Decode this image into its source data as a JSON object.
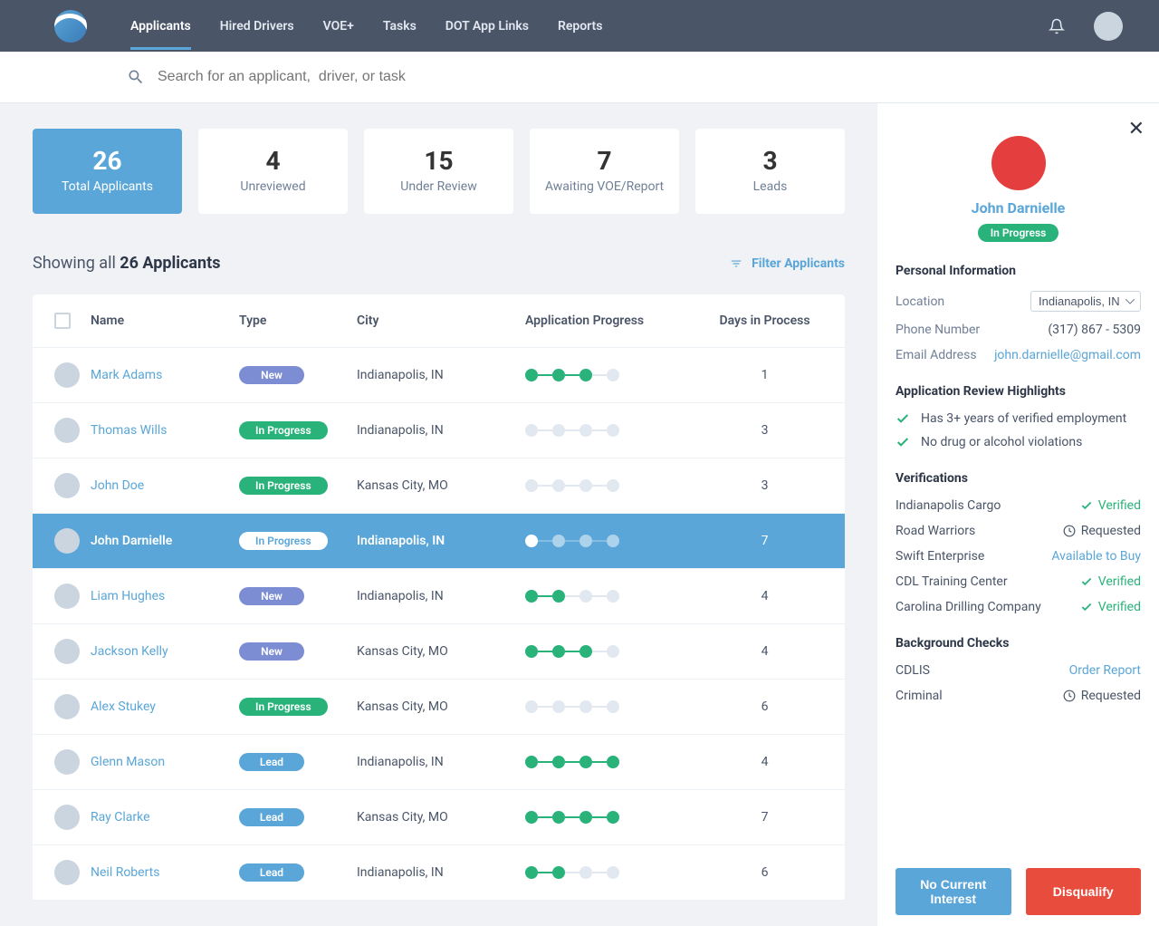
{
  "nav": {
    "items": [
      "Applicants",
      "Hired Drivers",
      "VOE+",
      "Tasks",
      "DOT App Links",
      "Reports"
    ],
    "active": 0
  },
  "search": {
    "placeholder": "Search for an applicant,  driver, or task"
  },
  "stats": [
    {
      "number": "26",
      "label": "Total Applicants",
      "active": true
    },
    {
      "number": "4",
      "label": "Unreviewed",
      "active": false
    },
    {
      "number": "15",
      "label": "Under Review",
      "active": false
    },
    {
      "number": "7",
      "label": "Awaiting VOE/Report",
      "active": false
    },
    {
      "number": "3",
      "label": "Leads",
      "active": false
    }
  ],
  "showing": {
    "prefix": "Showing all ",
    "strong": "26 Applicants"
  },
  "filter_label": "Filter Applicants",
  "columns": {
    "name": "Name",
    "type": "Type",
    "city": "City",
    "progress": "Application Progress",
    "days": "Days in Process"
  },
  "rows": [
    {
      "name": "Mark Adams",
      "type": "New",
      "type_class": "new",
      "city": "Indianapolis, IN",
      "progress": [
        1,
        1,
        1,
        0
      ],
      "days": "1",
      "selected": false
    },
    {
      "name": "Thomas Wills",
      "type": "In Progress",
      "type_class": "inprogress",
      "city": "Indianapolis, IN",
      "progress": [
        0,
        0,
        0,
        0
      ],
      "days": "3",
      "selected": false
    },
    {
      "name": "John Doe",
      "type": "In Progress",
      "type_class": "inprogress",
      "city": "Kansas City, MO",
      "progress": [
        0,
        0,
        0,
        0
      ],
      "days": "3",
      "selected": false
    },
    {
      "name": "John Darnielle",
      "type": "In Progress",
      "type_class": "inprogress",
      "city": "Indianapolis, IN",
      "progress": [
        1,
        0,
        0,
        0
      ],
      "days": "7",
      "selected": true
    },
    {
      "name": "Liam Hughes",
      "type": "New",
      "type_class": "new",
      "city": "Indianapolis, IN",
      "progress": [
        1,
        1,
        0,
        0
      ],
      "days": "4",
      "selected": false
    },
    {
      "name": "Jackson Kelly",
      "type": "New",
      "type_class": "new",
      "city": "Kansas City, MO",
      "progress": [
        1,
        1,
        1,
        0
      ],
      "days": "4",
      "selected": false
    },
    {
      "name": "Alex Stukey",
      "type": "In Progress",
      "type_class": "inprogress",
      "city": "Kansas City, MO",
      "progress": [
        0,
        0,
        0,
        0
      ],
      "days": "6",
      "selected": false
    },
    {
      "name": "Glenn Mason",
      "type": "Lead",
      "type_class": "lead",
      "city": "Indianapolis, IN",
      "progress": [
        1,
        1,
        1,
        1
      ],
      "days": "4",
      "selected": false
    },
    {
      "name": "Ray Clarke",
      "type": "Lead",
      "type_class": "lead",
      "city": "Kansas City, MO",
      "progress": [
        1,
        1,
        1,
        1
      ],
      "days": "7",
      "selected": false
    },
    {
      "name": "Neil Roberts",
      "type": "Lead",
      "type_class": "lead",
      "city": "Indianapolis, IN",
      "progress": [
        1,
        1,
        0,
        0
      ],
      "days": "6",
      "selected": false
    }
  ],
  "detail": {
    "name": "John Darnielle",
    "status": "In Progress",
    "personal_title": "Personal Information",
    "location_label": "Location",
    "location_value": "Indianapolis, IN",
    "phone_label": "Phone Number",
    "phone_value": "(317) 867 - 5309",
    "email_label": "Email Address",
    "email_value": "john.darnielle@gmail.com",
    "highlights_title": "Application Review Highlights",
    "highlights": [
      "Has 3+ years of verified employment",
      "No drug or alcohol violations"
    ],
    "verifications_title": "Verifications",
    "verifications": [
      {
        "name": "Indianapolis Cargo",
        "status": "Verified",
        "type": "verified"
      },
      {
        "name": "Road Warriors",
        "status": "Requested",
        "type": "requested"
      },
      {
        "name": "Swift Enterprise",
        "status": "Available to Buy",
        "type": "buy"
      },
      {
        "name": "CDL Training Center",
        "status": "Verified",
        "type": "verified"
      },
      {
        "name": "Carolina Drilling Company",
        "status": "Verified",
        "type": "verified"
      }
    ],
    "bg_title": "Background Checks",
    "bg_checks": [
      {
        "name": "CDLIS",
        "status": "Order Report",
        "type": "buy"
      },
      {
        "name": "Criminal",
        "status": "Requested",
        "type": "requested"
      }
    ],
    "btn_nocurrent": "No Current Interest",
    "btn_disqualify": "Disqualify"
  }
}
